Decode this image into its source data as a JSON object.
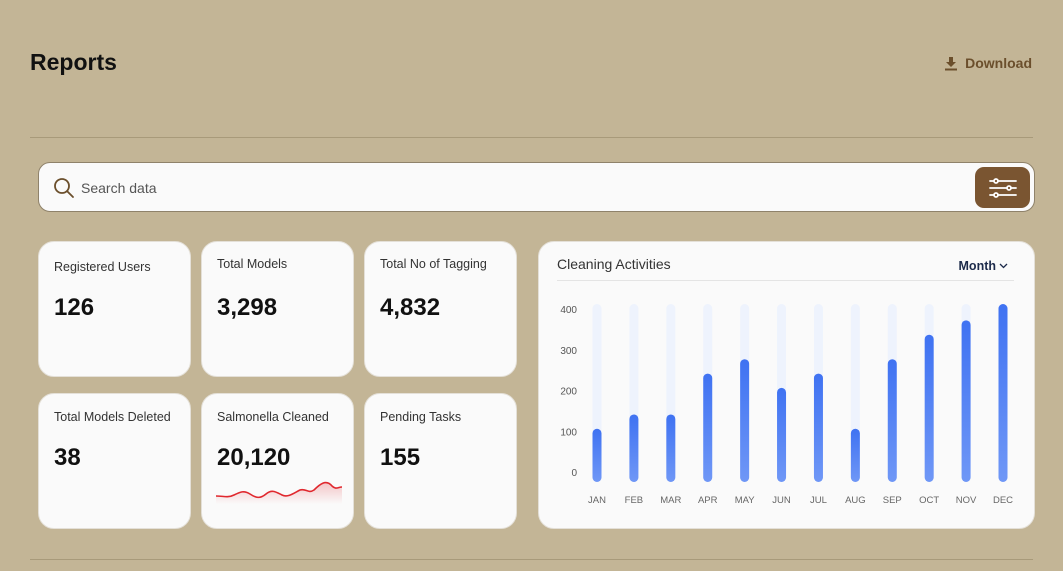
{
  "header": {
    "title": "Reports",
    "download_label": "Download"
  },
  "search": {
    "placeholder": "Search data"
  },
  "stats": [
    {
      "label": "Registered Users",
      "value": "126"
    },
    {
      "label": "Total Models",
      "value": "3,298"
    },
    {
      "label": "Total No of Tagging",
      "value": "4,832"
    },
    {
      "label": "Total Models Deleted",
      "value": "38"
    },
    {
      "label": "Salmonella Cleaned",
      "value": "20,120"
    },
    {
      "label": "Pending Tasks",
      "value": "155"
    }
  ],
  "colors": {
    "background": "#c3b596",
    "accent": "#7a5531",
    "bar": "#4f7df3",
    "sparkline": "#e0282e"
  },
  "chart_data": {
    "type": "bar",
    "title": "Cleaning Activities",
    "period_select": "Month",
    "categories": [
      "JAN",
      "FEB",
      "MAR",
      "APR",
      "MAY",
      "JUN",
      "JUL",
      "AUG",
      "SEP",
      "OCT",
      "NOV",
      "DEC"
    ],
    "values": [
      130,
      165,
      165,
      265,
      300,
      230,
      265,
      130,
      300,
      360,
      395,
      435
    ],
    "yticks": [
      0,
      100,
      200,
      300,
      400
    ],
    "ylim": [
      0,
      435
    ],
    "grid": false,
    "legend": "none"
  }
}
